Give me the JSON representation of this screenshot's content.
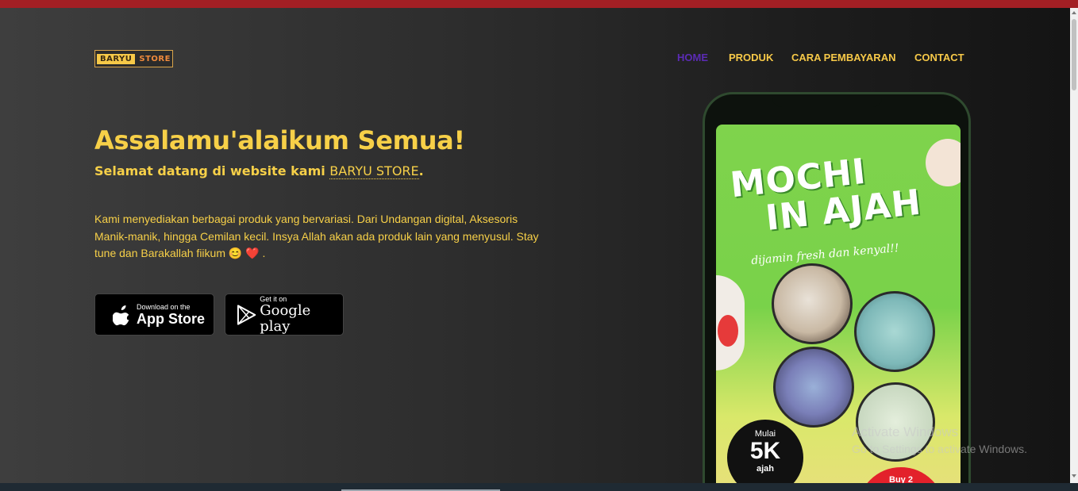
{
  "brand": {
    "part1": "BARYU",
    "part2": "STORE"
  },
  "nav": {
    "items": [
      {
        "label": "HOME",
        "active": true
      },
      {
        "label": "PRODUK"
      },
      {
        "label": "CARA PEMBAYARAN"
      },
      {
        "label": "CONTACT"
      }
    ]
  },
  "hero": {
    "title": "Assalamu'alaikum Semua!",
    "subtitle_prefix": "Selamat datang di website kami",
    "subtitle_brand": "BARYU STORE",
    "subtitle_suffix": ".",
    "description": "Kami menyediakan berbagai produk yang bervariasi. Dari Undangan digital, Aksesoris Manik-manik, hingga Cemilan kecil. Insya Allah akan ada produk lain yang menyusul. Stay tune dan Barakallah fiikum 😊 ❤️ ."
  },
  "buttons": {
    "appstore": {
      "small": "Download on the",
      "big": "App Store"
    },
    "googleplay": {
      "small": "Get it on",
      "big": "Google play"
    }
  },
  "phone_promo": {
    "title_line1": "MOCHI",
    "title_line2": "IN AJAH",
    "tagline": "dijamin fresh dan kenyal!!",
    "badge_line1": "Mulai",
    "badge_line2": "5K",
    "badge_line3": "ajah",
    "buy_label": "Buy 2"
  },
  "watermark": {
    "line1": "Activate Windows",
    "line2": "Go to Settings to activate Windows."
  },
  "colors": {
    "accent": "#f7d048",
    "active_nav": "#5b2bb5",
    "topbar": "#a31f24"
  }
}
